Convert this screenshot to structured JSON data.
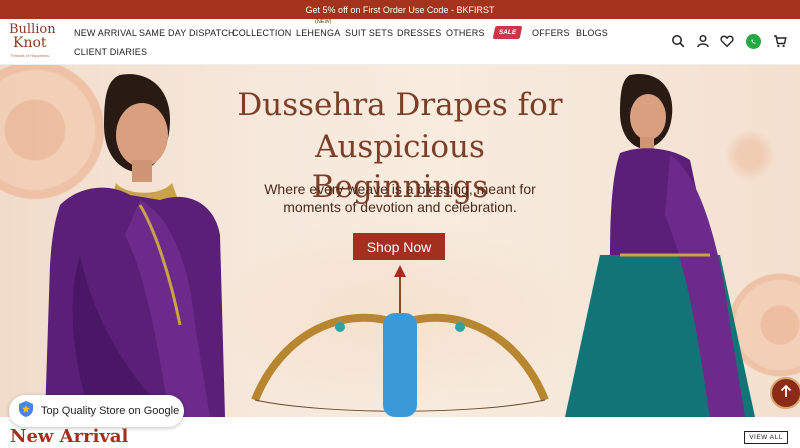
{
  "promo": {
    "text": "Get 5% off on First Order Use Code - BKFIRST"
  },
  "logo": {
    "line1": "Bullion",
    "line2": "Knot",
    "tagline": "Threads of Happiness"
  },
  "nav": {
    "new_arrival": "NEW ARRIVAL",
    "same_day_dispatch": "SAME DAY DISPATCH",
    "collection": "COLLECTION",
    "lehenga": "LEHENGA",
    "lehenga_badge": "(NEW)",
    "suit_sets": "SUIT SETS",
    "dresses": "DRESSES",
    "others": "OTHERS",
    "sale": "SALE",
    "offers": "OFFERS",
    "blogs": "BLOGS",
    "client_diaries": "CLIENT DIARIES"
  },
  "icons": {
    "search": "search-icon",
    "account": "user-icon",
    "wishlist": "heart-icon",
    "whatsapp": "whatsapp-icon",
    "cart": "cart-icon"
  },
  "hero": {
    "title_line1": "Dussehra Drapes for",
    "title_line2": "Auspicious Beginnings",
    "subtitle_line1": "Where every weave is a blessing, meant for",
    "subtitle_line2": "moments of devotion and celebration.",
    "cta": "Shop Now"
  },
  "google_badge": {
    "text": "Top Quality Store on Google"
  },
  "new_arrival_section": {
    "title": "New Arrival",
    "view_all": "VIEW ALL"
  },
  "colors": {
    "brand": "#a3331c",
    "hero_bg": "#f6e7da",
    "hero_title": "#7a3f26",
    "sale_badge": "#c8384a",
    "whatsapp": "#25a742"
  }
}
